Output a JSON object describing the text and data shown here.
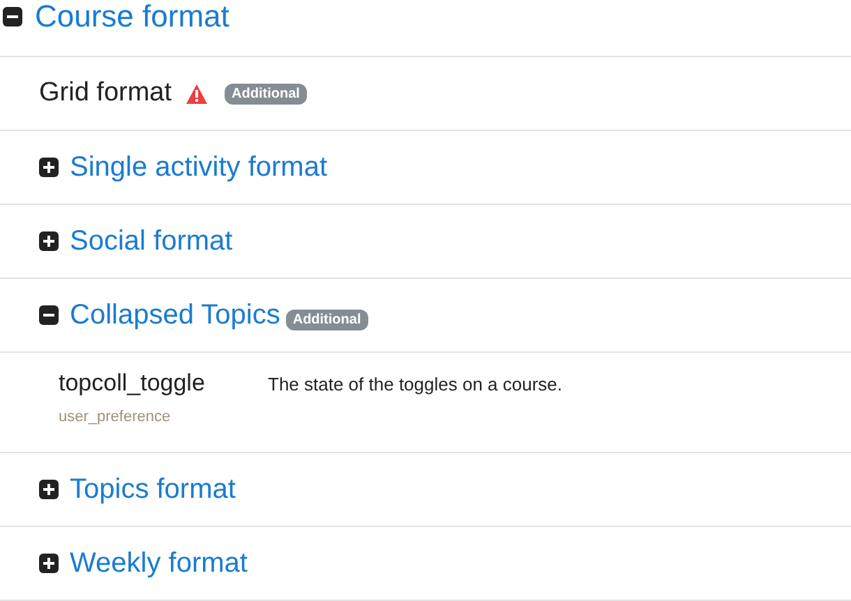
{
  "title": {
    "text": "Course format",
    "expanded": true
  },
  "items": [
    {
      "kind": "plugin",
      "name": "Grid format",
      "warning": true,
      "badge": "Additional"
    },
    {
      "kind": "section",
      "name": "Single activity format",
      "expanded": false
    },
    {
      "kind": "section",
      "name": "Social format",
      "expanded": false
    },
    {
      "kind": "section",
      "name": "Collapsed Topics",
      "expanded": true,
      "badge": "Additional",
      "entries": [
        {
          "name": "topcoll_toggle",
          "type": "user_preference",
          "description": "The state of the toggles on a course."
        }
      ]
    },
    {
      "kind": "section",
      "name": "Topics format",
      "expanded": false
    },
    {
      "kind": "section",
      "name": "Weekly format",
      "expanded": false
    }
  ]
}
